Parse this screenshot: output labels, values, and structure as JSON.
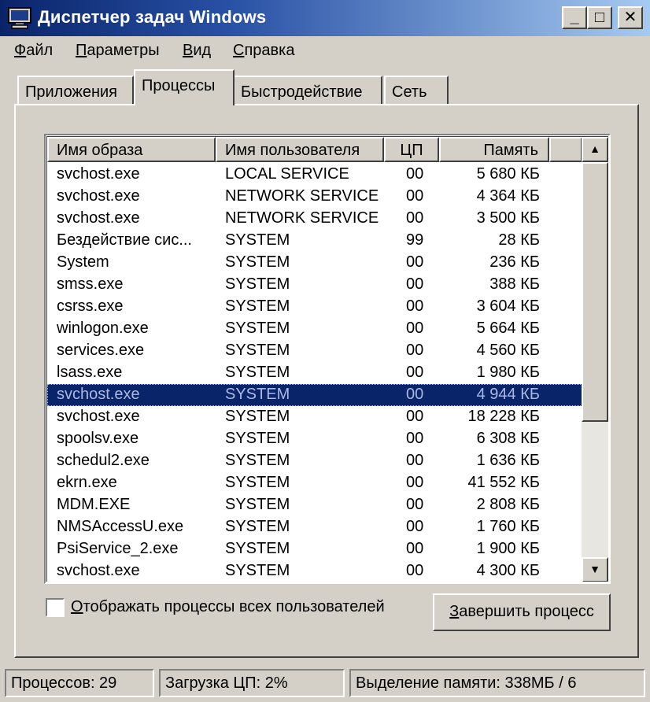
{
  "window": {
    "title": "Диспетчер задач Windows",
    "min_glyph": "_",
    "max_glyph": "□",
    "close_glyph": "✕"
  },
  "menu": [
    {
      "label": "Файл",
      "ul": "Ф",
      "rest": "айл"
    },
    {
      "label": "Параметры",
      "ul": "П",
      "rest": "араметры"
    },
    {
      "label": "Вид",
      "ul": "В",
      "rest": "ид"
    },
    {
      "label": "Справка",
      "ul": "С",
      "rest": "правка"
    }
  ],
  "tabs": [
    {
      "label": "Приложения",
      "active": false
    },
    {
      "label": "Процессы",
      "active": true
    },
    {
      "label": "Быстродействие",
      "active": false
    },
    {
      "label": "Сеть",
      "active": false
    }
  ],
  "columns": [
    "Имя образа",
    "Имя пользователя",
    "ЦП",
    "Память"
  ],
  "processes": [
    {
      "name": "svchost.exe",
      "user": "LOCAL SERVICE",
      "cpu": "00",
      "mem": "5 680 КБ"
    },
    {
      "name": "svchost.exe",
      "user": "NETWORK SERVICE",
      "cpu": "00",
      "mem": "4 364 КБ"
    },
    {
      "name": "svchost.exe",
      "user": "NETWORK SERVICE",
      "cpu": "00",
      "mem": "3 500 КБ"
    },
    {
      "name": "Бездействие сис...",
      "user": "SYSTEM",
      "cpu": "99",
      "mem": "28 КБ"
    },
    {
      "name": "System",
      "user": "SYSTEM",
      "cpu": "00",
      "mem": "236 КБ"
    },
    {
      "name": "smss.exe",
      "user": "SYSTEM",
      "cpu": "00",
      "mem": "388 КБ"
    },
    {
      "name": "csrss.exe",
      "user": "SYSTEM",
      "cpu": "00",
      "mem": "3 604 КБ"
    },
    {
      "name": "winlogon.exe",
      "user": "SYSTEM",
      "cpu": "00",
      "mem": "5 664 КБ"
    },
    {
      "name": "services.exe",
      "user": "SYSTEM",
      "cpu": "00",
      "mem": "4 560 КБ"
    },
    {
      "name": "lsass.exe",
      "user": "SYSTEM",
      "cpu": "00",
      "mem": "1 980 КБ"
    },
    {
      "name": "svchost.exe",
      "user": "SYSTEM",
      "cpu": "00",
      "mem": "4 944 КБ",
      "selected": true
    },
    {
      "name": "svchost.exe",
      "user": "SYSTEM",
      "cpu": "00",
      "mem": "18 228 КБ"
    },
    {
      "name": "spoolsv.exe",
      "user": "SYSTEM",
      "cpu": "00",
      "mem": "6 308 КБ"
    },
    {
      "name": "schedul2.exe",
      "user": "SYSTEM",
      "cpu": "00",
      "mem": "1 636 КБ"
    },
    {
      "name": "ekrn.exe",
      "user": "SYSTEM",
      "cpu": "00",
      "mem": "41 552 КБ"
    },
    {
      "name": "MDM.EXE",
      "user": "SYSTEM",
      "cpu": "00",
      "mem": "2 808 КБ"
    },
    {
      "name": "NMSAccessU.exe",
      "user": "SYSTEM",
      "cpu": "00",
      "mem": "1 760 КБ"
    },
    {
      "name": "PsiService_2.exe",
      "user": "SYSTEM",
      "cpu": "00",
      "mem": "1 900 КБ"
    },
    {
      "name": "svchost.exe",
      "user": "SYSTEM",
      "cpu": "00",
      "mem": "4 300 КБ"
    }
  ],
  "checkbox": {
    "label": "Отображать процессы всех пользователей",
    "ul": "О",
    "rest": "тображать процессы всех пользователей",
    "checked": false
  },
  "end_button": {
    "label": "Завершить процесс",
    "ul": "З",
    "rest": "авершить процесс"
  },
  "status": {
    "processes": "Процессов: 29",
    "cpu": "Загрузка ЦП: 2%",
    "memory": "Выделение памяти: 338МБ / 6"
  },
  "colors": {
    "title_start": "#0a246a",
    "title_end": "#a6caf0",
    "face": "#d4d0c8",
    "selection": "#0a246a"
  },
  "icons": {
    "app": "monitor-icon",
    "scroll_up": "▲",
    "scroll_down": "▼"
  }
}
